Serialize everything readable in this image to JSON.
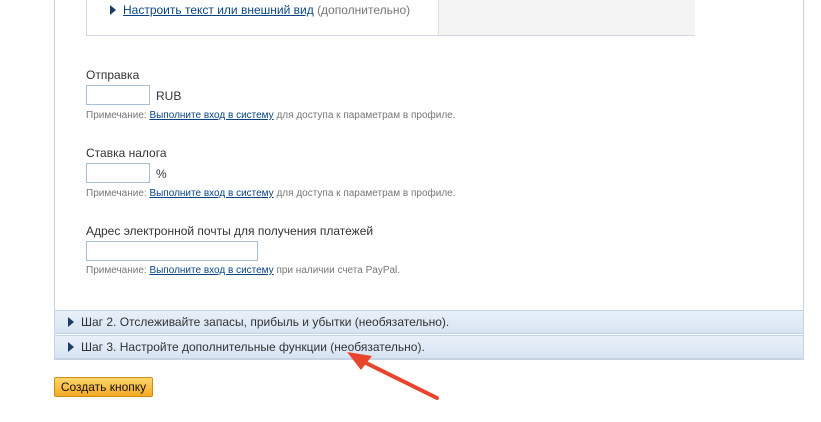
{
  "customize": {
    "link_text": "Настроить текст или внешний вид",
    "suffix": "(дополнительно)"
  },
  "shipping": {
    "label": "Отправка",
    "value": "",
    "unit": "RUB",
    "note_prefix": "Примечание:",
    "note_link": "Выполните вход в систему",
    "note_suffix": "для доступа к параметрам в профиле."
  },
  "tax": {
    "label": "Ставка налога",
    "value": "",
    "unit": "%",
    "note_prefix": "Примечание:",
    "note_link": "Выполните вход в систему",
    "note_suffix": "для доступа к параметрам в профиле."
  },
  "email": {
    "label": "Адрес электронной почты для получения платежей",
    "value": "",
    "note_prefix": "Примечание:",
    "note_link": "Выполните вход в систему",
    "note_suffix": "при наличии счета PayPal."
  },
  "steps": [
    {
      "label": "Шаг 2. Отслеживайте запасы, прибыль и убытки (необязательно)."
    },
    {
      "label": "Шаг 3. Настройте дополнительные функции (необязательно)."
    }
  ],
  "create_button": {
    "label": "Создать кнопку"
  },
  "colors": {
    "link": "#084482",
    "step_bar": "#dfe9f5",
    "button": "#f7b733",
    "annotation_arrow": "#e8452c"
  },
  "icons": {
    "expand": "expand-triangle-icon",
    "annotation": "annotation-arrow-icon"
  }
}
